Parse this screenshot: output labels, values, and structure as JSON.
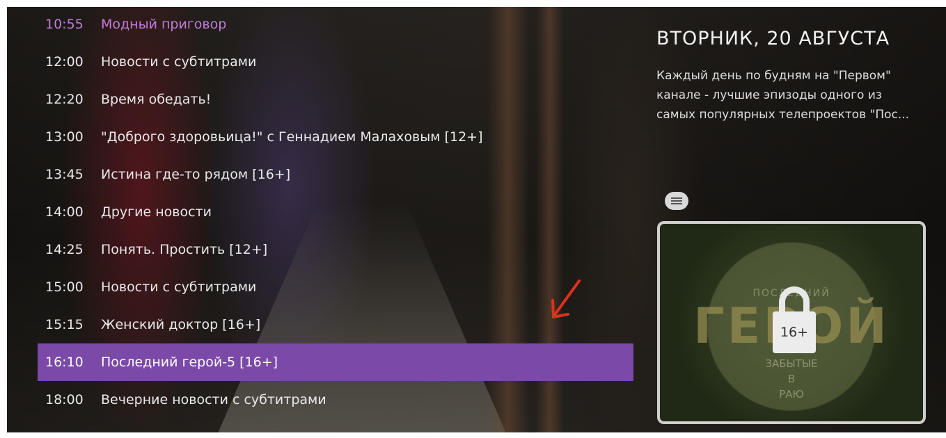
{
  "schedule": [
    {
      "time": "10:55",
      "title": "Модный приговор",
      "state": "current"
    },
    {
      "time": "12:00",
      "title": "Новости с субтитрами",
      "state": ""
    },
    {
      "time": "12:20",
      "title": "Время обедать!",
      "state": ""
    },
    {
      "time": "13:00",
      "title": "\"Доброго здоровьица!\" с Геннадием Малаховым [12+]",
      "state": ""
    },
    {
      "time": "13:45",
      "title": "Истина где-то рядом [16+]",
      "state": ""
    },
    {
      "time": "14:00",
      "title": "Другие новости",
      "state": ""
    },
    {
      "time": "14:25",
      "title": "Понять. Простить [12+]",
      "state": ""
    },
    {
      "time": "15:00",
      "title": "Новости с субтитрами",
      "state": ""
    },
    {
      "time": "15:15",
      "title": "Женский доктор [16+]",
      "state": ""
    },
    {
      "time": "16:10",
      "title": "Последний герой-5 [16+]",
      "state": "selected"
    },
    {
      "time": "18:00",
      "title": "Вечерние новости с субтитрами",
      "state": ""
    }
  ],
  "info": {
    "day": "ВТОРНИК, 20 АВГУСТА",
    "description": "Каждый день по будням на \"Первом\" канале - лучшие эпизоды одного из самых популярных телепроектов \"Пос...",
    "subtitles_icon": "subtitles-icon",
    "poster": {
      "subtitle": "ПОСЛЕДНИЙ",
      "title": "ГЕРОЙ",
      "tagline_1": "ЗАБЫТЫЕ",
      "tagline_2": "В",
      "tagline_3": "РАЮ",
      "age_rating": "16+",
      "lock_icon": "lock-icon"
    }
  },
  "colors": {
    "selected_row": "#7b49a8",
    "current_text": "#c27bd9",
    "annotation_arrow": "#e0301e"
  }
}
